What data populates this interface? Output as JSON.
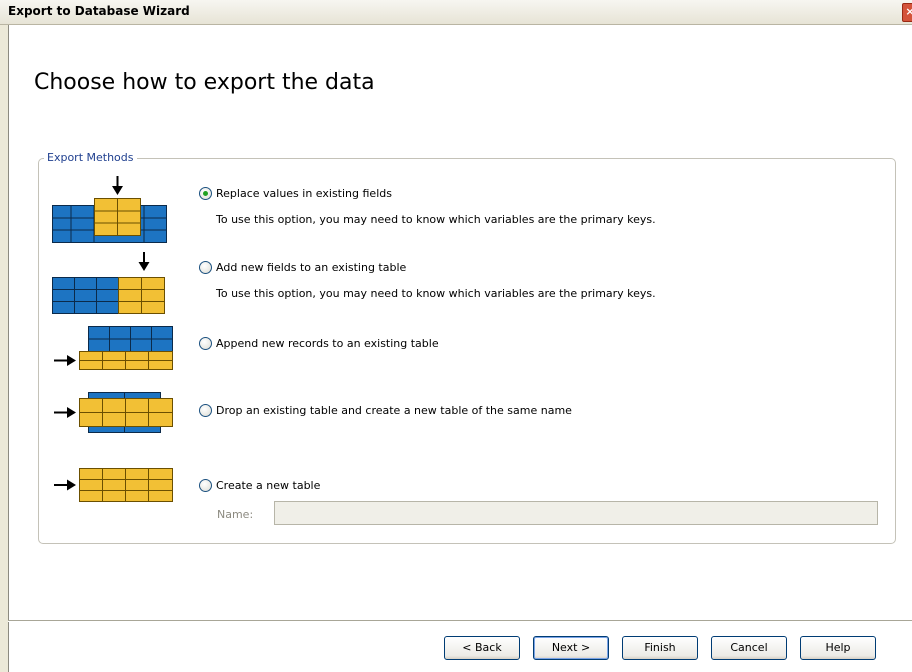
{
  "window": {
    "title": "Export to Database Wizard",
    "close_glyph": "×"
  },
  "page": {
    "heading": "Choose how to export the data"
  },
  "group": {
    "label": "Export Methods"
  },
  "options": [
    {
      "label": "Replace values in existing fields",
      "description": "To use this option, you may need to know which variables are the primary keys.",
      "checked": true,
      "icon": "replace-values-icon"
    },
    {
      "label": "Add new fields to an existing table",
      "description": "To use this option, you may need to know which variables are the primary keys.",
      "checked": false,
      "icon": "add-fields-icon"
    },
    {
      "label": "Append new records to an existing table",
      "checked": false,
      "icon": "append-records-icon"
    },
    {
      "label": "Drop an existing table and create a new table of the same name",
      "checked": false,
      "icon": "drop-table-icon"
    },
    {
      "label": "Create a new table",
      "checked": false,
      "icon": "create-table-icon"
    }
  ],
  "name_field": {
    "label": "Name:",
    "value": ""
  },
  "buttons": {
    "back": "< Back",
    "next": "Next >",
    "finish": "Finish",
    "cancel": "Cancel",
    "help": "Help"
  },
  "colors": {
    "blue_grid": "#1d74c2",
    "yellow_grid": "#f2c035",
    "radio_dot": "#21a121",
    "group_label": "#1f3f8f"
  }
}
